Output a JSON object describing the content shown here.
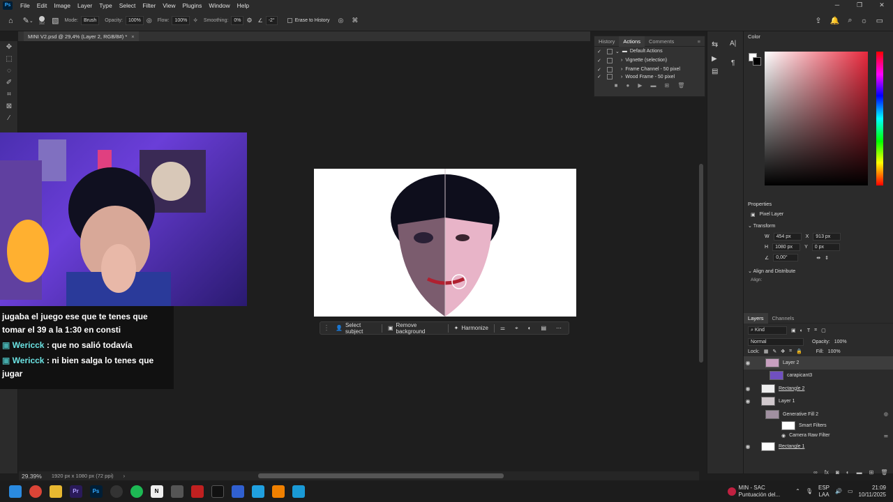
{
  "menubar": {
    "logo": "Ps",
    "items": [
      "File",
      "Edit",
      "Image",
      "Layer",
      "Type",
      "Select",
      "Filter",
      "View",
      "Plugins",
      "Window",
      "Help"
    ]
  },
  "options": {
    "mode_label": "Mode:",
    "mode_value": "Brush",
    "opacity_label": "Opacity:",
    "opacity_value": "100%",
    "flow_label": "Flow:",
    "flow_value": "100%",
    "smoothing_label": "Smoothing:",
    "smoothing_value": "0%",
    "angle_value": "-2°",
    "erase_history": "Erase to History",
    "brush_size": "162"
  },
  "document": {
    "tab_title": "MINI V2.psd @ 29,4% (Layer 2, RGB/8#) *",
    "close": "×"
  },
  "chat": {
    "lines": [
      {
        "user": "",
        "text": "jugaba el juego ese que te tenes que"
      },
      {
        "user": "",
        "text": "tomar el 39 a la 1:30 en consti"
      },
      {
        "user": "Wericck",
        "text": ": que no salió todavía"
      },
      {
        "user": "Wericck",
        "text": ": ni bien salga lo tenes que"
      },
      {
        "user": "",
        "text": "jugar"
      }
    ]
  },
  "contextbar": {
    "select_subject": "Select subject",
    "remove_background": "Remove background",
    "harmonize": "Harmonize"
  },
  "status": {
    "zoom": "29.39%",
    "doc_size": "1920 px x 1080 px (72 ppi)"
  },
  "actions_panel": {
    "tabs": [
      "History",
      "Actions",
      "Comments"
    ],
    "items": [
      "Default Actions",
      "Vignette (selection)",
      "Frame Channel - 50 pixel",
      "Wood Frame - 50 pixel"
    ]
  },
  "color_panel": {
    "title": "Color"
  },
  "properties": {
    "title": "Properties",
    "kind": "Pixel Layer",
    "transform": "Transform",
    "w": "454 px",
    "x": "913 px",
    "h": "1080 px",
    "y": "0 px",
    "angle": "0,00°",
    "align": "Align and Distribute",
    "align_label": "Align:"
  },
  "layers_panel": {
    "tabs": [
      "Layers",
      "Channels"
    ],
    "kind": "Kind",
    "blend": "Normal",
    "opacity_label": "Opacity:",
    "opacity": "100%",
    "lock_label": "Lock:",
    "fill_label": "Fill:",
    "fill": "100%",
    "layers": [
      "Layer 2",
      "carapicant3",
      "Rectangle 2",
      "Layer 1",
      "Generative Fill 2",
      "Smart Filters",
      "Camera Raw Filter",
      "Rectangle 1"
    ]
  },
  "taskbar": {
    "notif_title": "MIN - SAC",
    "notif_sub": "Puntuación del...",
    "lang": "ESP",
    "lang_sub": "LAA",
    "time": "21:09",
    "date": "10/11/2025"
  }
}
